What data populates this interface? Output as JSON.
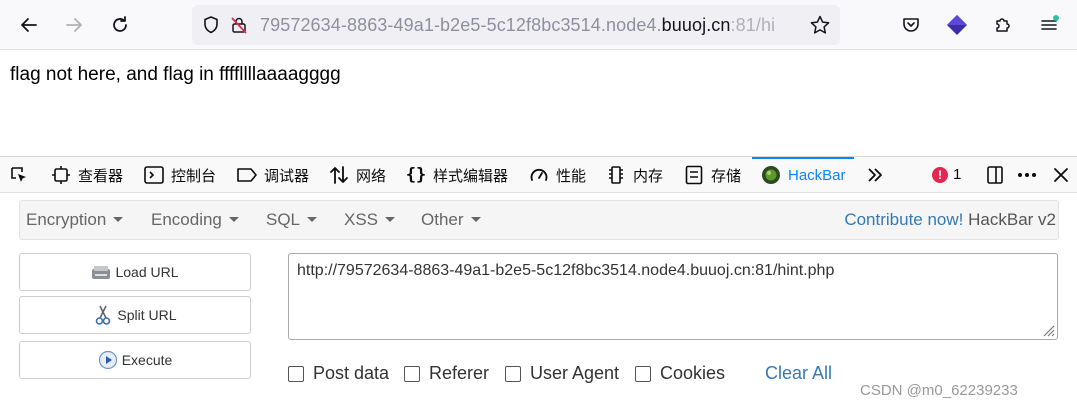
{
  "browser": {
    "url": {
      "prefix": "79572634-8863-49a1-b2e5-5c12f8bc3514.node4.",
      "host": "buuoj.cn",
      "suffix": ":81/hi"
    }
  },
  "page": {
    "text": "flag not here, and flag in ffffllllaaaagggg"
  },
  "devtools": {
    "tabs": [
      {
        "label": "查看器",
        "icon": "inspector-icon"
      },
      {
        "label": "控制台",
        "icon": "console-icon"
      },
      {
        "label": "调试器",
        "icon": "debugger-icon"
      },
      {
        "label": "网络",
        "icon": "network-icon"
      },
      {
        "label": "样式编辑器",
        "icon": "style-editor-icon"
      },
      {
        "label": "性能",
        "icon": "performance-icon"
      },
      {
        "label": "内存",
        "icon": "memory-icon"
      },
      {
        "label": "存储",
        "icon": "storage-icon"
      },
      {
        "label": "HackBar",
        "icon": "hackbar-icon"
      }
    ],
    "error_count": "1"
  },
  "hackbar": {
    "menu": [
      "Encryption",
      "Encoding",
      "SQL",
      "XSS",
      "Other"
    ],
    "contribute_link": "Contribute now!",
    "version": "HackBar v2",
    "buttons": {
      "load": "Load URL",
      "split": "Split URL",
      "execute": "Execute"
    },
    "url_value": "http://79572634-8863-49a1-b2e5-5c12f8bc3514.node4.buuoj.cn:81/hint.php",
    "options": [
      "Post data",
      "Referer",
      "User Agent",
      "Cookies"
    ],
    "clear_all": "Clear All"
  },
  "watermark": "CSDN @m0_62239233",
  "colors": {
    "accent": "#0a84ff",
    "link": "#337ab7",
    "error": "#e22850"
  }
}
